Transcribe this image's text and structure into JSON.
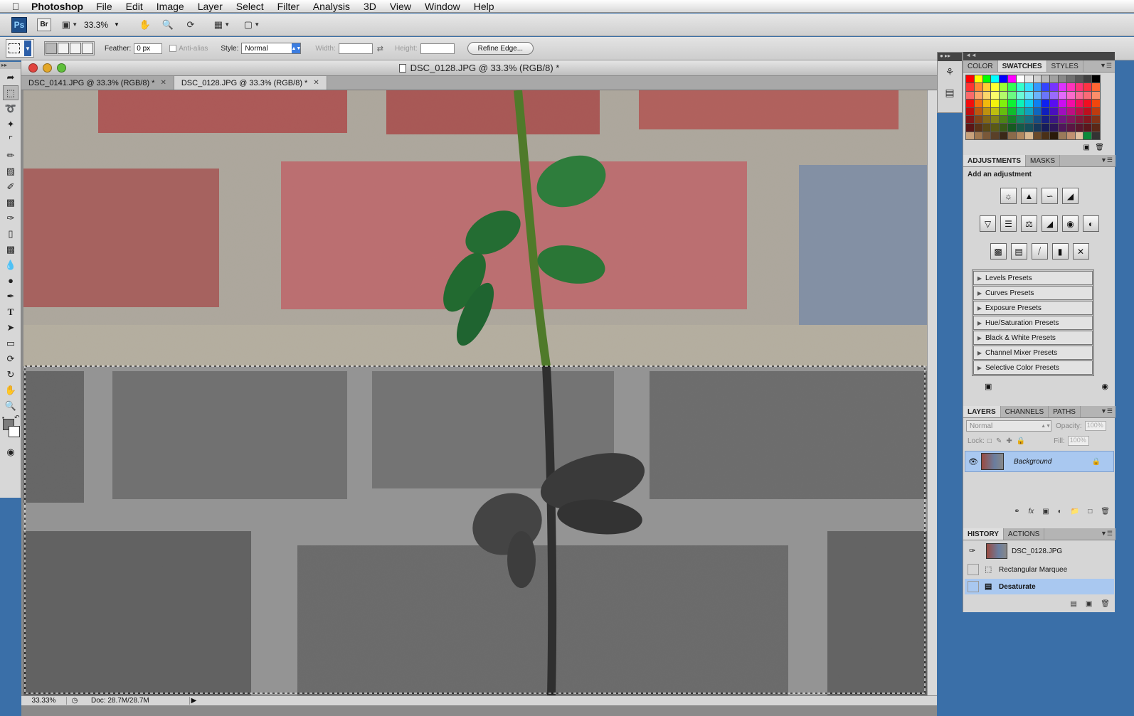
{
  "menubar": {
    "apple": "",
    "app_name": "Photoshop",
    "items": [
      "File",
      "Edit",
      "Image",
      "Layer",
      "Select",
      "Filter",
      "Analysis",
      "3D",
      "View",
      "Window",
      "Help"
    ]
  },
  "appbar": {
    "ps_label": "Ps",
    "br_label": "Br",
    "zoom": "33.3%"
  },
  "options": {
    "feather_label": "Feather:",
    "feather_value": "0 px",
    "antialias_label": "Anti-alias",
    "style_label": "Style:",
    "style_value": "Normal",
    "width_label": "Width:",
    "height_label": "Height:",
    "refine_label": "Refine Edge..."
  },
  "document": {
    "title": "DSC_0128.JPG @ 33.3% (RGB/8) *",
    "tabs": [
      {
        "label": "DSC_0141.JPG @ 33.3% (RGB/8) *",
        "active": false
      },
      {
        "label": "DSC_0128.JPG @ 33.3% (RGB/8) *",
        "active": true
      }
    ],
    "status_zoom": "33.33%",
    "status_doc": "Doc: 28.7M/28.7M"
  },
  "color_panel": {
    "tabs": [
      "Color",
      "Swatches",
      "Styles"
    ],
    "active_tab": "Swatches"
  },
  "adjustments_panel": {
    "tabs": [
      "Adjustments",
      "Masks"
    ],
    "title": "Add an adjustment",
    "presets": [
      "Levels Presets",
      "Curves Presets",
      "Exposure Presets",
      "Hue/Saturation Presets",
      "Black & White Presets",
      "Channel Mixer Presets",
      "Selective Color Presets"
    ]
  },
  "layers_panel": {
    "tabs": [
      "Layers",
      "Channels",
      "Paths"
    ],
    "blend_mode": "Normal",
    "opacity_label": "Opacity:",
    "opacity_value": "100%",
    "lock_label": "Lock:",
    "fill_label": "Fill:",
    "fill_value": "100%",
    "layers": [
      {
        "name": "Background",
        "locked": true
      }
    ]
  },
  "history_panel": {
    "tabs": [
      "History",
      "Actions"
    ],
    "snapshot": "DSC_0128.JPG",
    "states": [
      {
        "name": "Rectangular Marquee",
        "selected": false
      },
      {
        "name": "Desaturate",
        "selected": true
      }
    ]
  },
  "colors": {
    "accent_selection": "#a9c8f0",
    "desktop": "#3a6fa8"
  }
}
